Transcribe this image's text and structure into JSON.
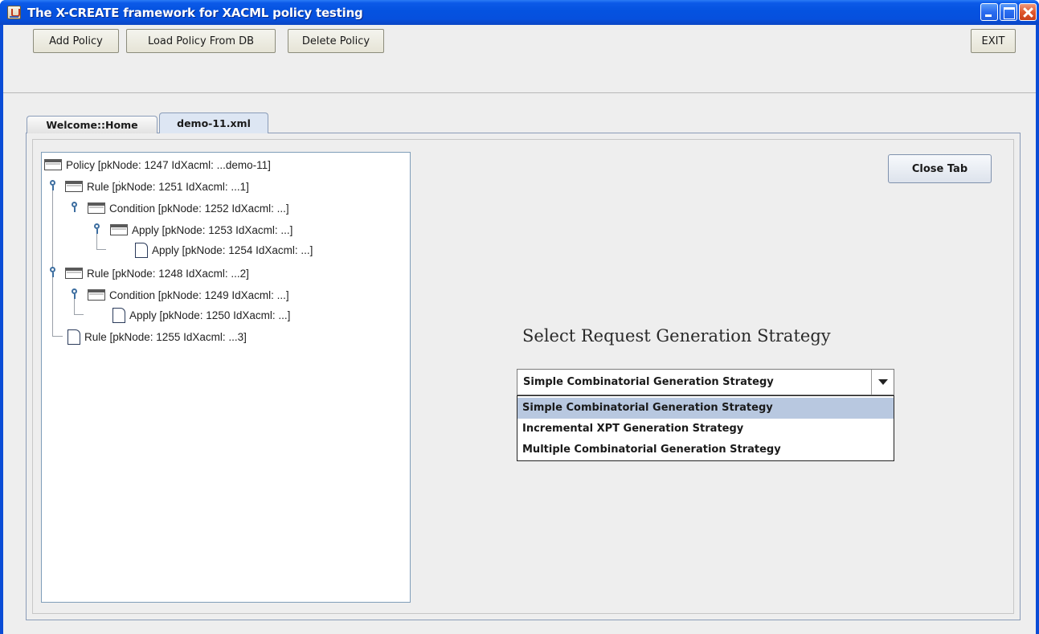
{
  "window": {
    "title": "The X-CREATE framework for XACML policy testing",
    "title_bar_color": "#0553e0"
  },
  "toolbar": {
    "add_policy_label": "Add Policy",
    "load_policy_label": "Load Policy From DB",
    "delete_policy_label": "Delete Policy",
    "exit_label": "EXIT"
  },
  "tabs": [
    {
      "label": "Welcome::Home",
      "active": false
    },
    {
      "label": "demo-11.xml",
      "active": true
    }
  ],
  "tree": {
    "nodes": [
      {
        "label": "Policy [pkNode: 1247 IdXacml: ...demo-11]",
        "type": "folder",
        "depth": 0
      },
      {
        "label": "Rule [pkNode: 1251 IdXacml: ...1]",
        "type": "folder",
        "depth": 0
      },
      {
        "label": "Condition [pkNode: 1252 IdXacml: ...]",
        "type": "folder",
        "depth": 1
      },
      {
        "label": "Apply [pkNode: 1253 IdXacml: ...]",
        "type": "folder",
        "depth": 2
      },
      {
        "label": "Apply [pkNode: 1254 IdXacml: ...]",
        "type": "leaf",
        "depth": 3
      },
      {
        "label": "Rule [pkNode: 1248 IdXacml: ...2]",
        "type": "folder",
        "depth": 0
      },
      {
        "label": "Condition [pkNode: 1249 IdXacml: ...]",
        "type": "folder",
        "depth": 1
      },
      {
        "label": "Apply [pkNode: 1250 IdXacml: ...]",
        "type": "leaf",
        "depth": 2
      },
      {
        "label": "Rule [pkNode: 1255 IdXacml: ...3]",
        "type": "leaf",
        "depth": 0
      }
    ]
  },
  "close_tab_label": "Close Tab",
  "strategy": {
    "heading": "Select Request Generation Strategy",
    "selected": "Simple Combinatorial Generation Strategy",
    "options": [
      "Simple Combinatorial Generation Strategy",
      "Incremental XPT Generation Strategy",
      "Multiple Combinatorial Generation Strategy"
    ],
    "highlight_color": "#b8c8e0"
  }
}
